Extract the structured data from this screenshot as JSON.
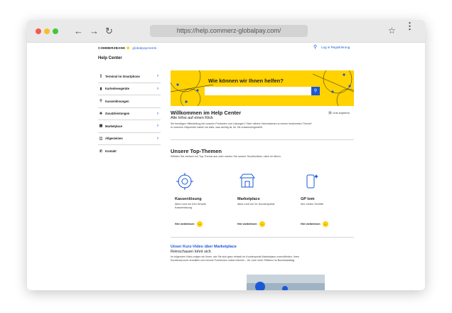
{
  "browser": {
    "url": "https://help.commerz-globalpay.com/",
    "back_icon": "←",
    "forward_icon": "→",
    "reload_icon": "↻",
    "star_icon": "☆",
    "menu_icon": "⋮"
  },
  "header": {
    "brand_left": "COMMERZBANK",
    "brand_right": "globalpayments",
    "login": "Log in Registrierung"
  },
  "help_center": {
    "title": "Help Center"
  },
  "sidebar": {
    "items": [
      {
        "label": "Terminal im Smartphone"
      },
      {
        "label": "Kartenlesegeräte"
      },
      {
        "label": "Kassenlösungen"
      },
      {
        "label": "Zusatzleistungen"
      },
      {
        "label": "Marketplace"
      },
      {
        "label": "Allgemeines"
      },
      {
        "label": "Kontakt"
      }
    ]
  },
  "hero": {
    "heading": "Wie können wir Ihnen helfen?",
    "search_placeholder": "",
    "accent": "#ffd200"
  },
  "welcome": {
    "heading": "Willkommen im Help Center",
    "subheading": "Alle Infos auf einen Klick",
    "text": "Sie benötigen Hilfestellung bei unseren Produkten und Lösungen? Oder nähere Informationen zu einem bestimmten Thema? In unserem Helpcenter haben wir alles, was wichtig ist, für Sie zusammengestellt.",
    "copy_link": "Link kopieren"
  },
  "top_topics": {
    "heading": "Unsere Top-Themen",
    "text": "Wählen Sie einfach ein Top-Thema aus oder nutzen Sie unsere Suchfunktion oben im Menü.",
    "cards": [
      {
        "title": "Kassenlösung",
        "desc": "Alles rund um Ihre Smarte Kassenlösung",
        "more": "Hier weiterlesen"
      },
      {
        "title": "Marketplace",
        "desc": "Alles rund um Ihr Kundenportal",
        "more": "Hier weiterlesen"
      },
      {
        "title": "GP tom",
        "desc": "Ihre ersten Schritte",
        "more": "Hier weiterlesen"
      }
    ]
  },
  "video": {
    "heading": "Unser Kurz-Video über Marketplace",
    "subheading": "Reinschauen lohnt sich",
    "text": "Im folgenden Video zeigen wir Ihnen, wie Sie sich ganz einfach im Kundenportal Marketplace zurechtfinden, Ihren Kundenaccount verwalten und clevere Funktionen nutzen können – für noch mehr Effizienz im Businessalltag."
  },
  "colors": {
    "brand_blue": "#1b58d6",
    "accent_yellow": "#ffd200"
  }
}
